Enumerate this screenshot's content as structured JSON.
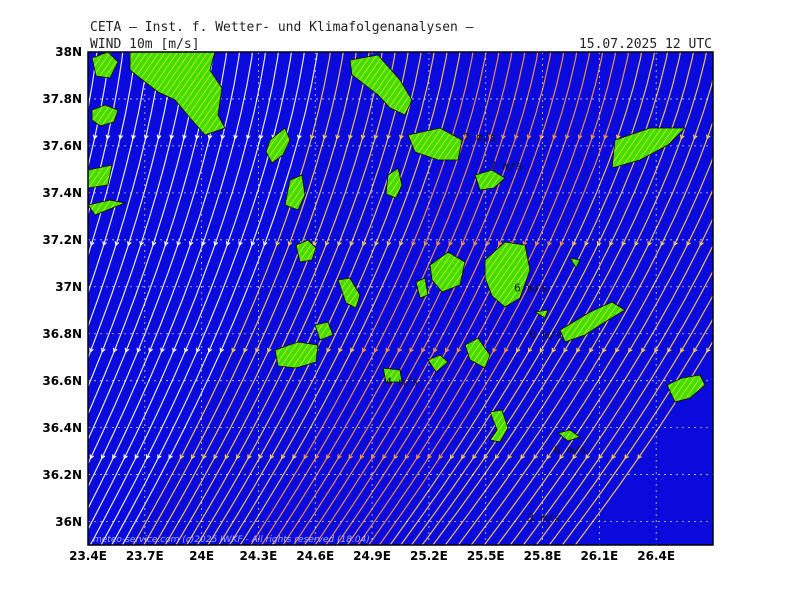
{
  "header": {
    "title": "CETA – Inst. f. Wetter- und Klimafolgenanalysen –",
    "parameter": "WIND 10m [m/s]",
    "valid_time": "15.07.2025 12 UTC"
  },
  "footer": {
    "credit": "meteo-service.com (c)2025 IWKF - All rights reserved (18.04)"
  },
  "axes": {
    "lat_labels": [
      "38N",
      "37.8N",
      "37.6N",
      "37.4N",
      "37.2N",
      "37N",
      "36.8N",
      "36.6N",
      "36.4N",
      "36.2N",
      "36N"
    ],
    "lat_values": [
      38,
      37.8,
      37.6,
      37.4,
      37.2,
      37,
      36.8,
      36.6,
      36.4,
      36.2,
      36
    ],
    "lon_labels": [
      "23.4E",
      "23.7E",
      "24E",
      "24.3E",
      "24.6E",
      "24.9E",
      "25.2E",
      "25.5E",
      "25.8E",
      "26.1E",
      "26.4E"
    ],
    "lon_values": [
      23.4,
      23.7,
      24.0,
      24.3,
      24.6,
      24.9,
      25.2,
      25.5,
      25.8,
      26.1,
      26.4
    ]
  },
  "colors": {
    "sea": "#0a0adc",
    "land": "#44dd00",
    "land_hatch": "#ffee22",
    "stream_slow": "#ffffff",
    "stream_mid": "#ffd24a",
    "stream_fast": "#ff9a3c",
    "grid": "#ffffff",
    "frame": "#000000"
  },
  "wind_labels": [
    {
      "text": "7 m/s",
      "lon": 25.38,
      "lat": 37.62
    },
    {
      "text": "7 m/s",
      "lon": 25.52,
      "lat": 37.5
    },
    {
      "text": "4 m/s",
      "lon": 24.97,
      "lat": 36.58
    },
    {
      "text": "6 m/s",
      "lon": 25.65,
      "lat": 36.98
    },
    {
      "text": "6 m/s",
      "lon": 25.73,
      "lat": 36.78
    },
    {
      "text": "6 m/s",
      "lon": 25.86,
      "lat": 36.29
    },
    {
      "text": "3 m/s",
      "lon": 25.72,
      "lat": 36.0
    }
  ]
}
